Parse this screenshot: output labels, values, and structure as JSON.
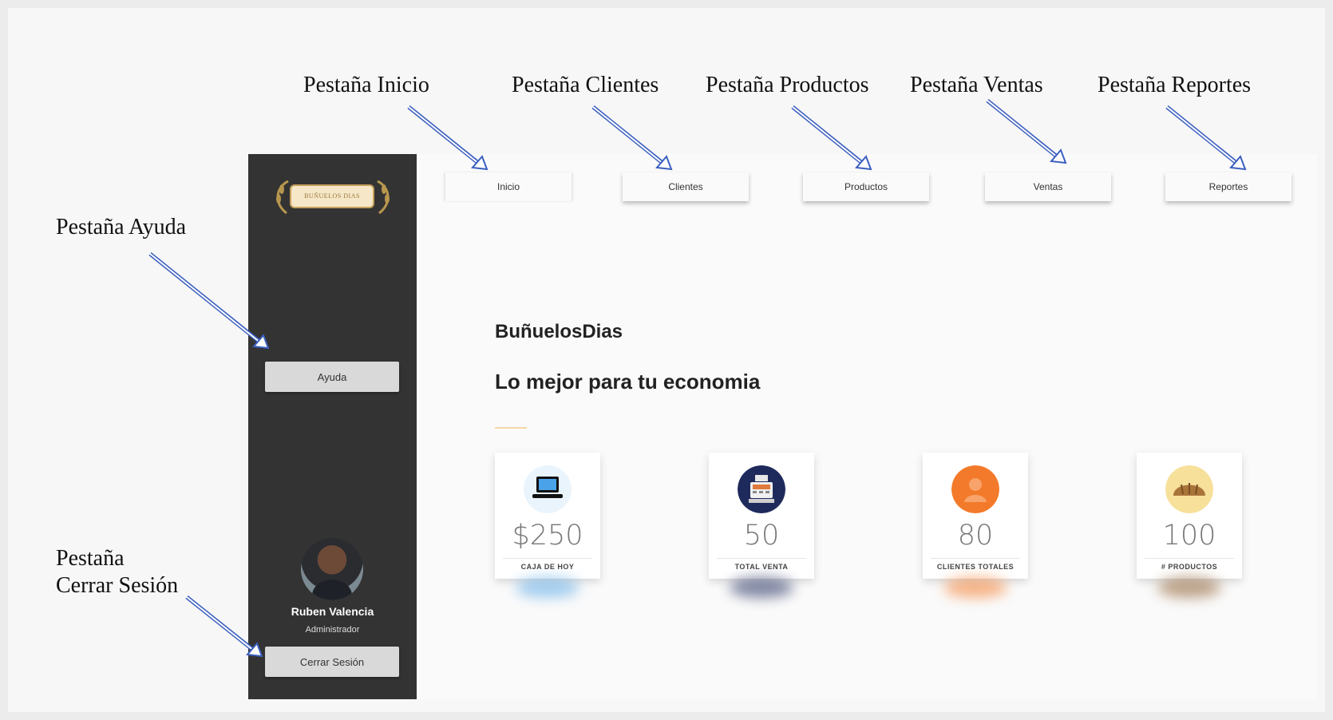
{
  "annotations": {
    "inicio": "Pestaña Inicio",
    "clientes": "Pestaña Clientes",
    "productos": "Pestaña Productos",
    "ventas": "Pestaña Ventas",
    "reportes": "Pestaña Reportes",
    "ayuda": "Pestaña Ayuda",
    "cerrar_line1": "Pestaña",
    "cerrar_line2": "Cerrar Sesión",
    "arrow_color": "#3b5fc0"
  },
  "sidebar": {
    "logo_text": "BUÑUELOS DIAS",
    "help_button": "Ayuda",
    "user": {
      "name": "Ruben Valencia",
      "role": "Administrador"
    },
    "logout_button": "Cerrar Sesión",
    "background": "#333333"
  },
  "tabs": [
    {
      "label": "Inicio",
      "active": true
    },
    {
      "label": "Clientes",
      "active": false
    },
    {
      "label": "Productos",
      "active": false
    },
    {
      "label": "Ventas",
      "active": false
    },
    {
      "label": "Reportes",
      "active": false
    }
  ],
  "hero": {
    "brand": "BuñuelosDias",
    "tagline": "Lo mejor para tu economia",
    "accent_color": "#f3d7a4"
  },
  "stats": [
    {
      "icon": "laptop-icon",
      "value": "$250",
      "label": "CAJA DE HOY",
      "color": "#5aa8e6"
    },
    {
      "icon": "cash-register-icon",
      "value": "50",
      "label": "TOTAL VENTA",
      "color": "#1f2a5c"
    },
    {
      "icon": "client-icon",
      "value": "80",
      "label": "CLIENTES TOTALES",
      "color": "#f37a2a"
    },
    {
      "icon": "bread-icon",
      "value": "100",
      "label": "# PRODUCTOS",
      "color": "#8a5a2b"
    }
  ]
}
